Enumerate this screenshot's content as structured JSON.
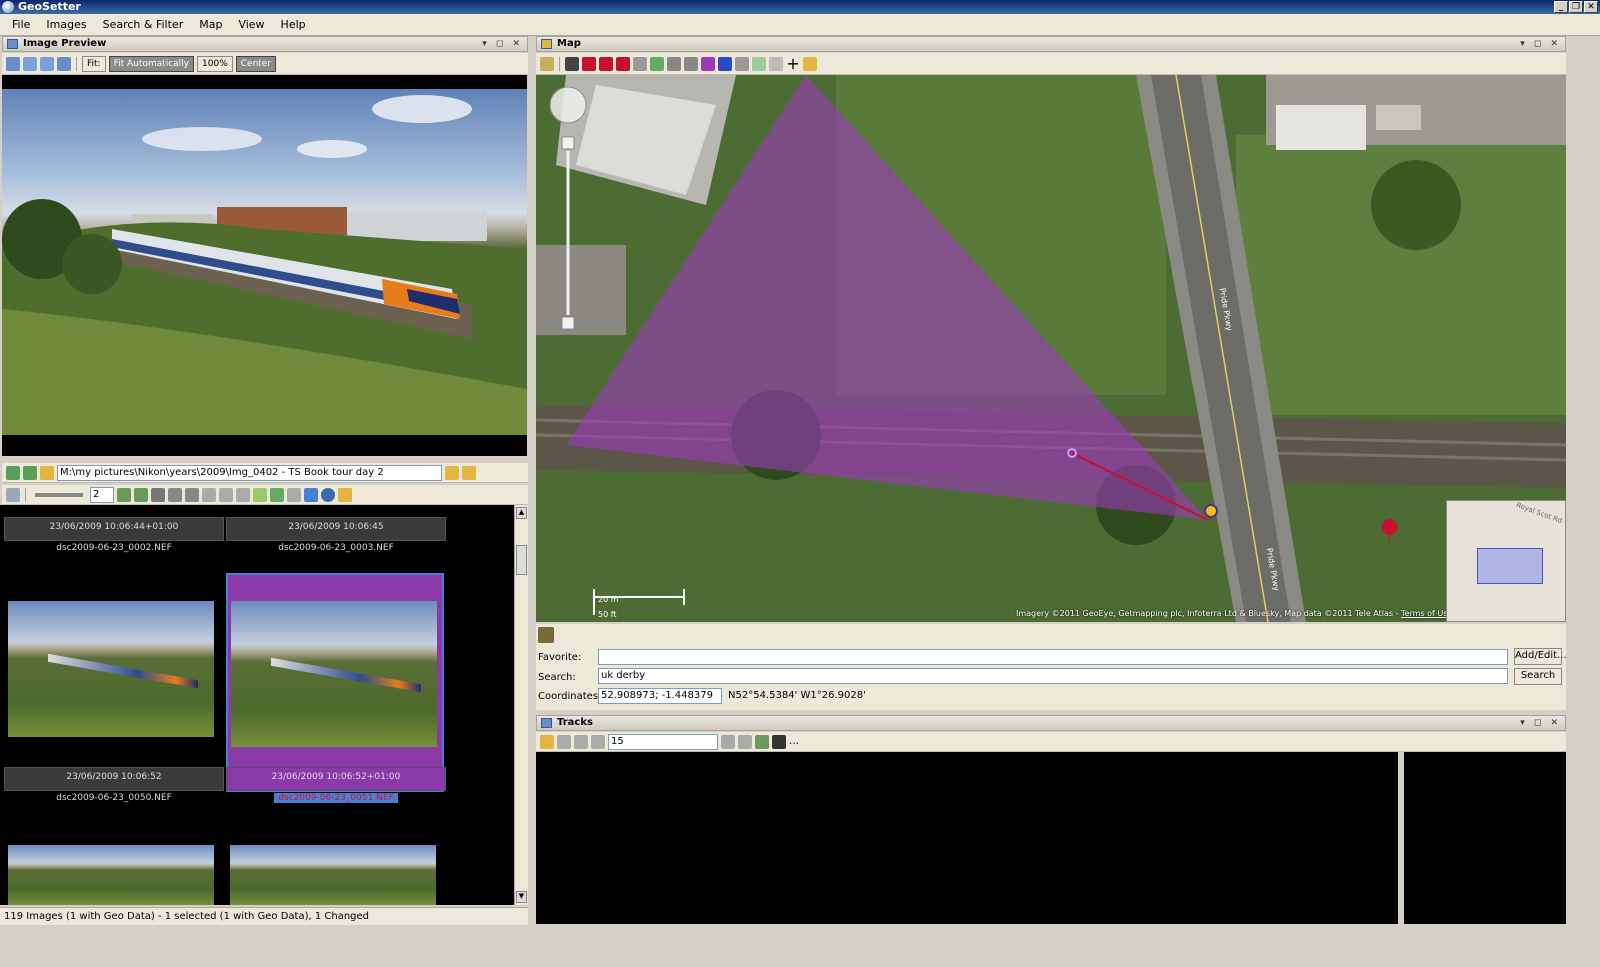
{
  "window": {
    "title": "GeoSetter"
  },
  "menu": [
    "File",
    "Images",
    "Search & Filter",
    "Map",
    "View",
    "Help"
  ],
  "preview": {
    "title": "Image Preview",
    "fit_label": "Fit:",
    "fit_auto_label": "Fit Automatically",
    "zoom": "100%",
    "center_label": "Center"
  },
  "browser": {
    "path": "M:\\my pictures\\Nikon\\years\\2009\\Img_0402 - TS Book tour day 2",
    "thumb_size": "2",
    "items": [
      {
        "date": "23/06/2009 10:06:44+01:00",
        "name": "dsc2009-06-23_0002.NEF"
      },
      {
        "date": "23/06/2009 10:06:45",
        "name": "dsc2009-06-23_0003.NEF"
      },
      {
        "date": "23/06/2009 10:06:52",
        "name": "dsc2009-06-23_0050.NEF"
      },
      {
        "date": "23/06/2009 10:06:52+01:00",
        "name": "dsc2009-06-23_0051.NEF"
      }
    ],
    "status": "119 Images (1 with Geo Data) - 1 selected (1 with Geo Data), 1 Changed"
  },
  "map": {
    "title": "Map",
    "scale_top": "20 m",
    "scale_bottom": "50 ft",
    "copyright": "Imagery ©2011 GeoEye, Getmapping plc, Infoterra Ltd & Bluesky, Map data ©2011 Tele Atlas -",
    "terms": "Terms of Use",
    "road_label_1": "Pride Pkwy",
    "road_label_2": "Pride Pkwy",
    "minimap_road": "Royal Scot Rd"
  },
  "form": {
    "favorite_label": "Favorite:",
    "favorite_value": "",
    "addedit_label": "Add/Edit...",
    "search_label": "Search:",
    "search_value": "uk derby",
    "search_button": "Search",
    "coords_label": "Coordinates:",
    "coords_value": "52.908973; -1.448379",
    "coords_dms": "N52°54.5384' W1°26.9028'"
  },
  "tracks": {
    "title": "Tracks",
    "timezone": "15"
  },
  "colors": {
    "selection": "#4a7fd8",
    "viewcone": "#9a3ab8",
    "marker": "#c8102e"
  }
}
